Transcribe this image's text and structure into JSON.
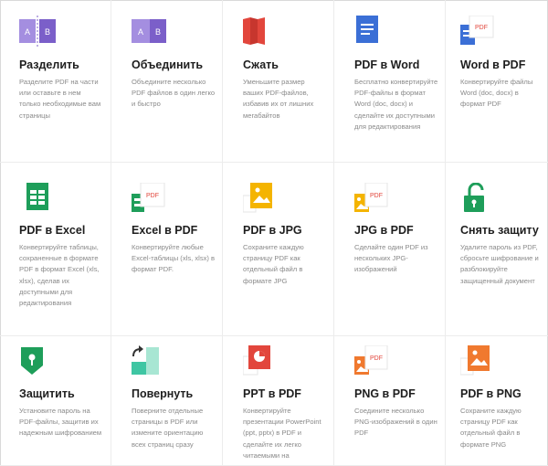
{
  "tools": [
    {
      "icon": "split-icon",
      "title": "Разделить",
      "desc": "Разделите PDF на части или оставьте в нем только необходимые вам страницы"
    },
    {
      "icon": "merge-icon",
      "title": "Объединить",
      "desc": "Объедините несколько PDF файлов в один легко и быстро"
    },
    {
      "icon": "compress-icon",
      "title": "Сжать",
      "desc": "Уменьшите размер ваших PDF-файлов, избавив их от лишних мегабайтов"
    },
    {
      "icon": "pdf-to-word-icon",
      "title": "PDF в Word",
      "desc": "Бесплатно конвертируйте PDF-файлы в формат Word (doc, docx) и сделайте их доступными для редактирования"
    },
    {
      "icon": "word-to-pdf-icon",
      "title": "Word в PDF",
      "desc": "Конвертируйте файлы Word (doc, docx) в формат PDF"
    },
    {
      "icon": "pdf-to-excel-icon",
      "title": "PDF в Excel",
      "desc": "Конвертируйте таблицы, сохраненные в формате PDF в формат Excel (xls, xlsx), сделав их доступными для редактирования"
    },
    {
      "icon": "excel-to-pdf-icon",
      "title": "Excel в PDF",
      "desc": "Конвертируйте любые Excel-таблицы (xls, xlsx) в формат PDF."
    },
    {
      "icon": "pdf-to-jpg-icon",
      "title": "PDF в JPG",
      "desc": "Сохраните каждую страницу PDF как отдельный файл в формате JPG"
    },
    {
      "icon": "jpg-to-pdf-icon",
      "title": "JPG в PDF",
      "desc": "Сделайте один PDF из нескольких JPG-изображений"
    },
    {
      "icon": "unlock-icon",
      "title": "Снять защиту",
      "desc": "Удалите пароль из PDF, сбросьте шифрование и разблокируйте защищенный документ"
    },
    {
      "icon": "protect-icon",
      "title": "Защитить",
      "desc": "Установите пароль на PDF-файлы, защитив их надежным шифрованием"
    },
    {
      "icon": "rotate-icon",
      "title": "Повернуть",
      "desc": "Поверните отдельные страницы в PDF или измените ориентацию всех страниц сразу"
    },
    {
      "icon": "ppt-to-pdf-icon",
      "title": "PPT в PDF",
      "desc": "Конвертируйте презентации PowerPoint (ppt, pptx) в PDF и сделайте их легко читаемыми на"
    },
    {
      "icon": "png-to-pdf-icon",
      "title": "PNG в PDF",
      "desc": "Соедините несколько PNG-изображений в один PDF"
    },
    {
      "icon": "pdf-to-png-icon",
      "title": "PDF в PNG",
      "desc": "Сохраните каждую страницу PDF как отдельный файл в формате PNG"
    }
  ],
  "icon_labels": {
    "a": "A",
    "b": "B",
    "pdf": "PDF"
  },
  "colors": {
    "purple": "#7b5fc9",
    "purple_light": "#a48ee0",
    "red": "#e2463c",
    "blue": "#3b6fd6",
    "green": "#1e9e5a",
    "yellow": "#f4b400",
    "orange": "#f0792f",
    "mint": "#3fc6a3"
  }
}
